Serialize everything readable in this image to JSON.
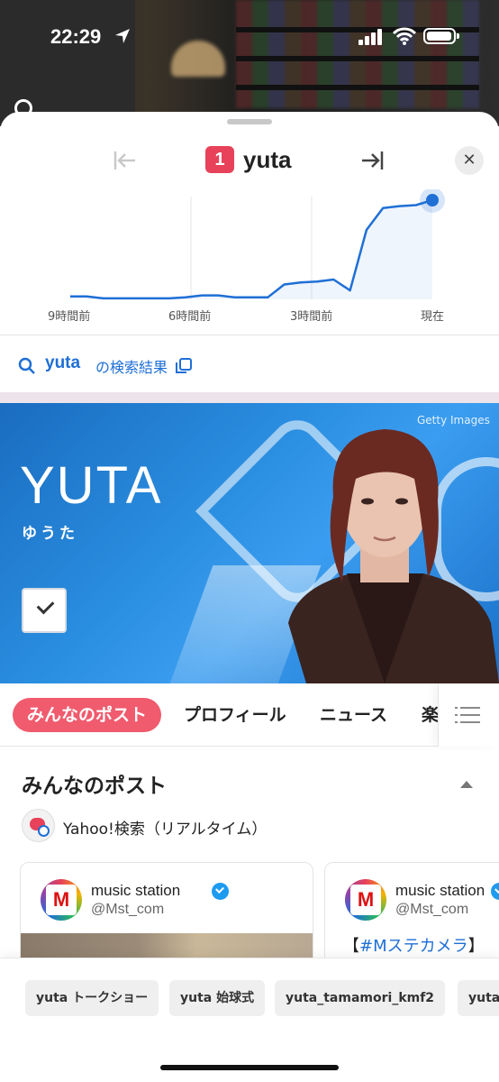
{
  "status_bar": {
    "time": "22:29"
  },
  "trend": {
    "rank": "1",
    "word": "yuta",
    "chart_labels": [
      "9時間前",
      "6時間前",
      "3時間前",
      "現在"
    ]
  },
  "chart_data": {
    "type": "line",
    "x": [
      "9時間前",
      "6時間前",
      "3時間前",
      "現在"
    ],
    "series": [
      {
        "values": [
          3,
          3,
          1,
          1,
          1,
          1,
          1,
          2,
          4,
          4,
          2,
          2,
          2,
          15,
          17,
          18,
          20,
          9,
          70,
          92,
          94,
          95,
          100
        ]
      }
    ],
    "ylim": [
      0,
      100
    ],
    "grid": true,
    "accent": "#1f6fd6"
  },
  "search_link": {
    "query": "yuta",
    "suffix": "の検索結果"
  },
  "hero": {
    "name": "YUTA",
    "kana": "ゆうた",
    "credit": "Getty Images"
  },
  "tabs": [
    "みんなのポスト",
    "プロフィール",
    "ニュース",
    "楽"
  ],
  "section": {
    "title": "みんなのポスト",
    "source": "Yahoo!検索（リアルタイム）"
  },
  "cards": [
    {
      "avatar_letter": "M",
      "name": "music station",
      "handle": "@Mst_com"
    },
    {
      "avatar_letter": "M",
      "name": "music station",
      "handle": "@Mst_com",
      "text_bracket_open": "【",
      "text_tag": "#Mステカメラ",
      "text_bracket_close": "】"
    }
  ],
  "suggestions": [
    "yuta トークショー",
    "yuta 始球式",
    "yuta_tamamori_kmf2",
    "yuta"
  ],
  "colors": {
    "badge": "#e8415a",
    "link": "#1f6fd6",
    "tab_active": "#f05b6e"
  }
}
